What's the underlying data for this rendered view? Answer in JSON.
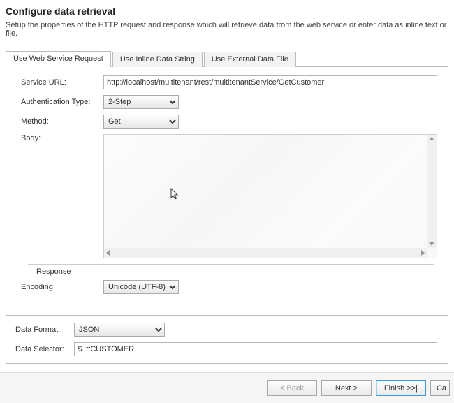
{
  "header": {
    "title": "Configure data retrieval",
    "description": "Setup the properties of the HTTP request and response which will retrieve data from the web service or enter data as inline text or file."
  },
  "tabs": [
    {
      "label": "Use Web Service Request",
      "active": true
    },
    {
      "label": "Use Inline Data String",
      "active": false
    },
    {
      "label": "Use External Data File",
      "active": false
    }
  ],
  "webServiceRequest": {
    "serviceUrl": {
      "label": "Service URL:",
      "value": "http://localhost/multitenant/rest/multitenantService/GetCustomer"
    },
    "authType": {
      "label": "Authentication Type:",
      "value": "2-Step"
    },
    "method": {
      "label": "Method:",
      "value": "Get"
    },
    "body": {
      "label": "Body:",
      "value": ""
    },
    "responseSection": "Response",
    "encoding": {
      "label": "Encoding:",
      "value": "Unicode (UTF-8)"
    }
  },
  "output": {
    "dataFormat": {
      "label": "Data Format:",
      "value": "JSON"
    },
    "dataSelector": {
      "label": "Data Selector:",
      "value": "$..ttCUSTOMER"
    }
  },
  "footnote": "* Service URL or data as file/inline text is required.",
  "buttons": {
    "back": "< Back",
    "next": "Next >",
    "finish": "Finish >>|",
    "cancel": "Ca"
  }
}
